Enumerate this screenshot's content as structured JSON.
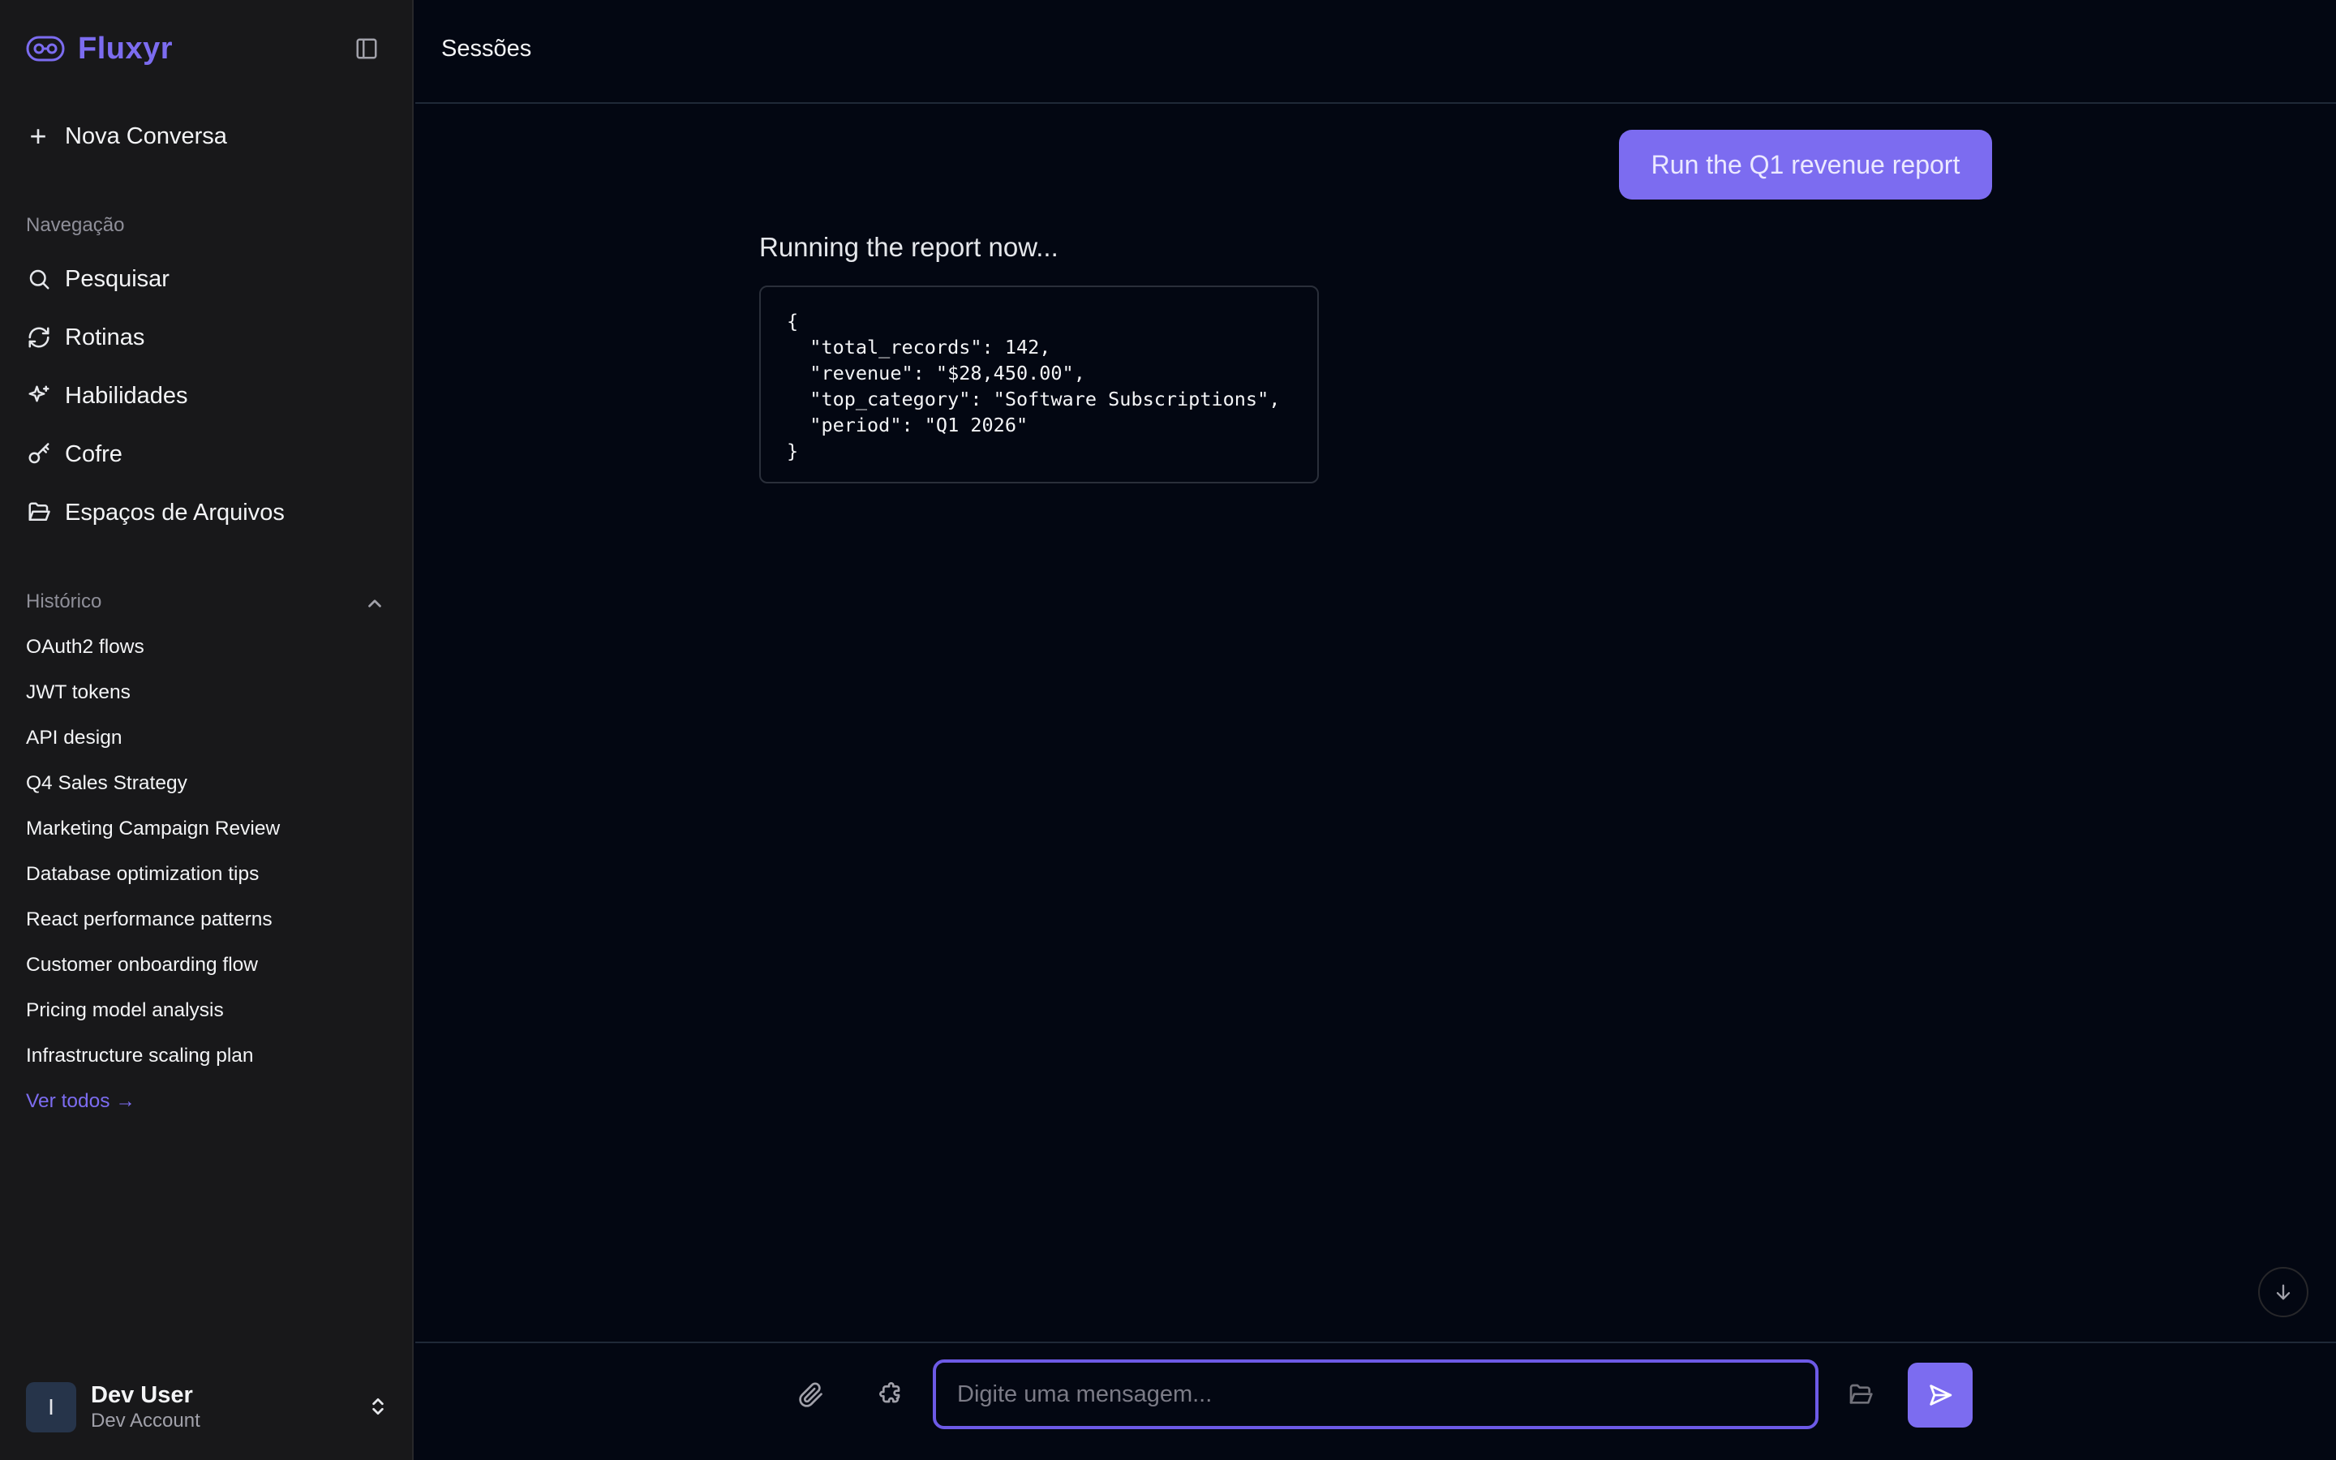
{
  "app": {
    "name": "Fluxyr"
  },
  "sidebar": {
    "new_chat_label": "Nova Conversa",
    "nav_title": "Navegação",
    "nav_items": [
      {
        "label": "Pesquisar",
        "icon": "search-icon"
      },
      {
        "label": "Rotinas",
        "icon": "refresh-icon"
      },
      {
        "label": "Habilidades",
        "icon": "sparkles-icon"
      },
      {
        "label": "Cofre",
        "icon": "key-icon"
      },
      {
        "label": "Espaços de Arquivos",
        "icon": "folder-open-icon"
      }
    ],
    "history_title": "Histórico",
    "history": [
      "OAuth2 flows",
      "JWT tokens",
      "API design",
      "Q4 Sales Strategy",
      "Marketing Campaign Review",
      "Database optimization tips",
      "React performance patterns",
      "Customer onboarding flow",
      "Pricing model analysis",
      "Infrastructure scaling plan"
    ],
    "see_all_label": "Ver todos →",
    "user": {
      "initial": "I",
      "name": "Dev User",
      "account": "Dev Account"
    }
  },
  "header": {
    "title": "Sessões"
  },
  "chat": {
    "user_message": "Run the Q1 revenue report",
    "assistant_text": "Running the report now...",
    "code": "{\n  \"total_records\": 142,\n  \"revenue\": \"$28,450.00\",\n  \"top_category\": \"Software Subscriptions\",\n  \"period\": \"Q1 2026\"\n}"
  },
  "composer": {
    "placeholder": "Digite uma mensagem..."
  },
  "colors": {
    "accent": "#7c6cf0",
    "background": "#030712",
    "sidebar": "#18181a"
  }
}
